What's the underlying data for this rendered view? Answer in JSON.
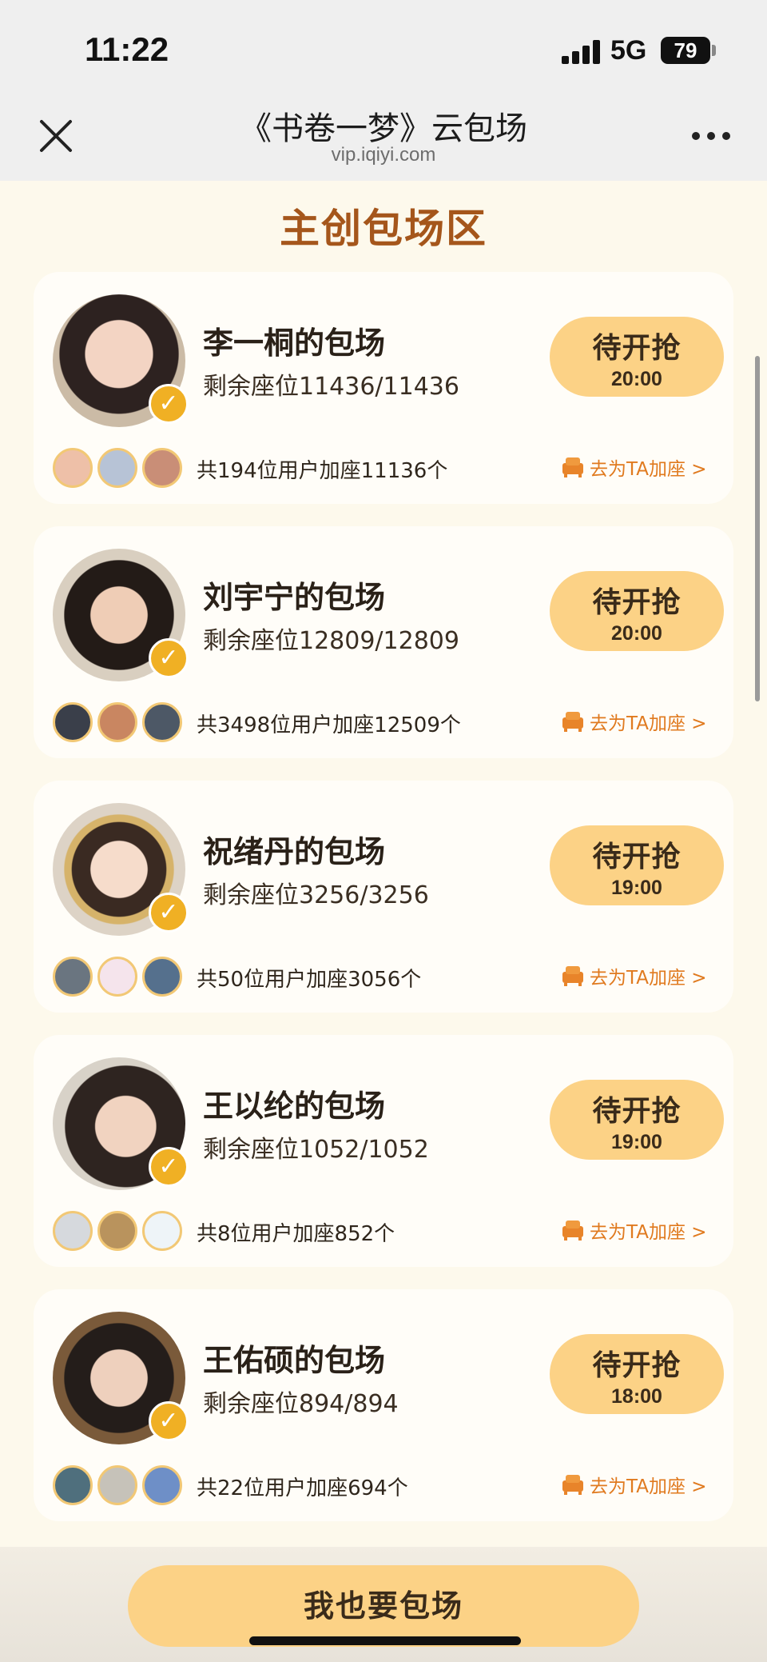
{
  "status_bar": {
    "time": "11:22",
    "network": "5G",
    "battery": "79"
  },
  "header": {
    "title": "《书卷一梦》云包场",
    "subtitle": "vip.iqiyi.com"
  },
  "section_title": "主创包场区",
  "cards": [
    {
      "name": "李一桐的包场",
      "seats": "剩余座位11436/11436",
      "button_label": "待开抢",
      "button_time": "20:00",
      "users_text": "共194位用户加座11136个",
      "add_seat_label": "去为TA加座 >"
    },
    {
      "name": "刘宇宁的包场",
      "seats": "剩余座位12809/12809",
      "button_label": "待开抢",
      "button_time": "20:00",
      "users_text": "共3498位用户加座12509个",
      "add_seat_label": "去为TA加座 >"
    },
    {
      "name": "祝绪丹的包场",
      "seats": "剩余座位3256/3256",
      "button_label": "待开抢",
      "button_time": "19:00",
      "users_text": "共50位用户加座3056个",
      "add_seat_label": "去为TA加座 >"
    },
    {
      "name": "王以纶的包场",
      "seats": "剩余座位1052/1052",
      "button_label": "待开抢",
      "button_time": "19:00",
      "users_text": "共8位用户加座852个",
      "add_seat_label": "去为TA加座 >"
    },
    {
      "name": "王佑硕的包场",
      "seats": "剩余座位894/894",
      "button_label": "待开抢",
      "button_time": "18:00",
      "users_text": "共22位用户加座694个",
      "add_seat_label": "去为TA加座 >"
    }
  ],
  "cta_label": "我也要包场",
  "colors": {
    "accent_orange": "#e07a1f",
    "section_title": "#a5561b",
    "button_bg": "#fcd286",
    "verify_badge": "#f0b024"
  }
}
